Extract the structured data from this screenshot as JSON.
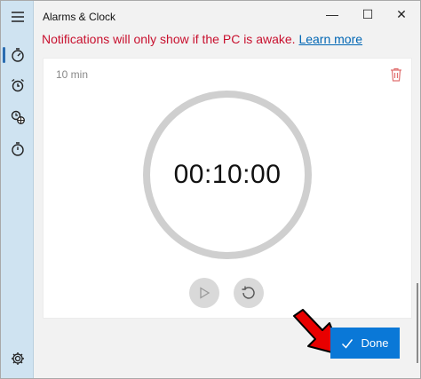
{
  "window": {
    "title": "Alarms & Clock",
    "controls": {
      "minimize": "—",
      "maximize": "☐",
      "close": "✕"
    }
  },
  "sidebar": {
    "items": [
      {
        "icon": "hamburger-menu-icon"
      },
      {
        "icon": "timer-icon",
        "active": true
      },
      {
        "icon": "alarm-clock-icon"
      },
      {
        "icon": "world-clock-icon"
      },
      {
        "icon": "stopwatch-icon"
      },
      {
        "icon": "gear-icon"
      }
    ]
  },
  "notification": {
    "message": "Notifications will only show if the PC is awake.",
    "link": "Learn more"
  },
  "timer": {
    "name": "10 min",
    "time": "00:10:00"
  },
  "actions": {
    "done": "Done"
  },
  "colors": {
    "sidebar_bg": "#cfe3f1",
    "accent": "#0a78d7",
    "warning_text": "#c8102e",
    "delete_icon": "#e07070",
    "ring": "#cfcfcf",
    "annotation_arrow": "#e80000"
  }
}
